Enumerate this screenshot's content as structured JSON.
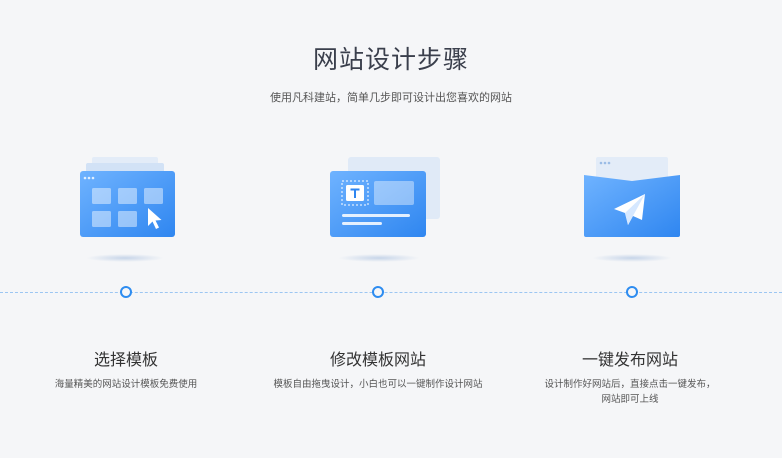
{
  "header": {
    "title": "网站设计步骤",
    "subtitle": "使用凡科建站，简单几步即可设计出您喜欢的网站"
  },
  "steps": [
    {
      "title": "选择模板",
      "desc_lines": [
        "海量精美的网站设计模板免费使用"
      ],
      "icon": "template-window-icon"
    },
    {
      "title": "修改模板网站",
      "desc_lines": [
        "模板自由拖曳设计，小白也可以一键制作设计网站"
      ],
      "icon": "edit-text-icon"
    },
    {
      "title": "一键发布网站",
      "desc_lines": [
        "设计制作好网站后，直接点击一键发布，",
        "网站即可上线"
      ],
      "icon": "paper-plane-icon"
    }
  ],
  "colors": {
    "accent": "#2d8cf0",
    "background": "#f5f6f8",
    "title": "#3a3f4c"
  }
}
